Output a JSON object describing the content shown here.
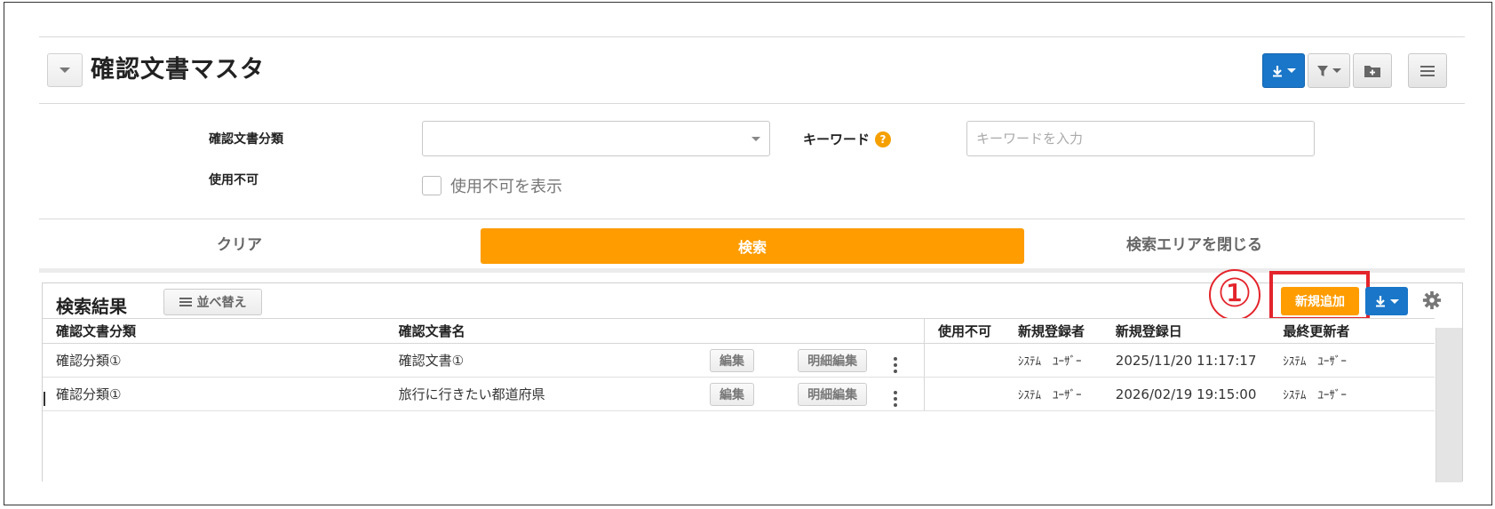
{
  "header": {
    "title": "確認文書マスタ"
  },
  "search": {
    "category_label": "確認文書分類",
    "category_value": "",
    "keyword_label": "キーワード",
    "keyword_placeholder": "キーワードを入力",
    "keyword_value": "",
    "disabled_label": "使用不可",
    "show_disabled_label": "使用不可を表示",
    "show_disabled_checked": false
  },
  "actions": {
    "clear": "クリア",
    "search": "検索",
    "close_area": "検索エリアを閉じる"
  },
  "results": {
    "title": "検索結果",
    "sort_label": "並べ替え",
    "add_label": "新規追加",
    "annotation": "①",
    "columns": [
      "確認文書分類",
      "確認文書名",
      "使用不可",
      "新規登録者",
      "新規登録日",
      "最終更新者"
    ],
    "edit_label": "編集",
    "detail_edit_label": "明細編集",
    "rows": [
      {
        "category": "確認分類①",
        "name": "確認文書①",
        "disabled": "",
        "creator": "ｼｽﾃﾑ　ﾕｰｻﾞｰ",
        "created": "2025/11/20 11:17:17",
        "updater": "ｼｽﾃﾑ　ﾕｰｻﾞｰ"
      },
      {
        "category": "確認分類①",
        "name": "旅行に行きたい都道府県",
        "disabled": "",
        "creator": "ｼｽﾃﾑ　ﾕｰｻﾞｰ",
        "created": "2026/02/19 19:15:00",
        "updater": "ｼｽﾃﾑ　ﾕｰｻﾞｰ"
      }
    ]
  },
  "colors": {
    "accent_orange": "#ff9c00",
    "accent_blue": "#1976c8",
    "annotation_red": "#e3242b"
  },
  "icons": {
    "download": "download-icon",
    "filter": "filter-icon",
    "folder_add": "folder-add-icon",
    "menu": "hamburger-menu-icon",
    "help": "question-icon",
    "sort": "sort-icon",
    "settings": "gear-icon"
  }
}
